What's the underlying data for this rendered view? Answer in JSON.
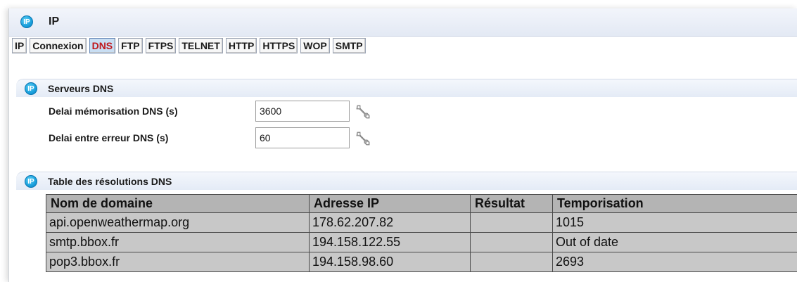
{
  "window": {
    "badge": "IP",
    "title": "IP"
  },
  "tabs": [
    {
      "label": "IP",
      "active": false
    },
    {
      "label": "Connexion",
      "active": false
    },
    {
      "label": "DNS",
      "active": true
    },
    {
      "label": "FTP",
      "active": false
    },
    {
      "label": "FTPS",
      "active": false
    },
    {
      "label": "TELNET",
      "active": false
    },
    {
      "label": "HTTP",
      "active": false
    },
    {
      "label": "HTTPS",
      "active": false
    },
    {
      "label": "WOP",
      "active": false
    },
    {
      "label": "SMTP",
      "active": false
    }
  ],
  "dns_servers": {
    "badge": "IP",
    "title": "Serveurs DNS",
    "fields": [
      {
        "label": "Delai mémorisation DNS (s)",
        "value": "3600"
      },
      {
        "label": "Delai entre erreur DNS (s)",
        "value": "60"
      }
    ]
  },
  "dns_table": {
    "badge": "IP",
    "title": "Table des résolutions DNS",
    "columns": [
      "Nom de domaine",
      "Adresse IP",
      "Résultat",
      "Temporisation"
    ],
    "rows": [
      [
        "api.openweathermap.org",
        "178.62.207.82",
        "",
        "1015"
      ],
      [
        "smtp.bbox.fr",
        "194.158.122.55",
        "",
        "Out of date"
      ],
      [
        "pop3.bbox.fr",
        "194.158.98.60",
        "",
        "2693"
      ]
    ]
  },
  "colors": {
    "active_tab_text": "#c0161b",
    "active_tab_bg": "#c8def3",
    "badge": "#1aa0dc",
    "table_cell_bg": "#c8c8c8",
    "table_header_bg": "#b4b4b4"
  },
  "icons": {
    "badge": "ip-badge-icon",
    "config": "wrench-icon"
  }
}
